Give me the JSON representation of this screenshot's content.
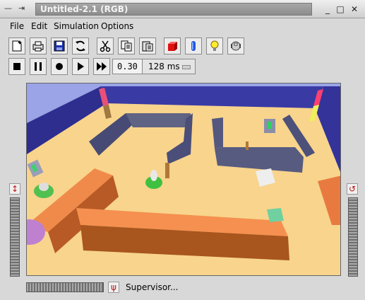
{
  "window": {
    "title": "Untitled-2.1 (RGB)",
    "ctl_minus": "—",
    "ctl_pin": "⇥",
    "minimize": "_",
    "maximize": "□",
    "close": "✕"
  },
  "menu": {
    "items": [
      "File",
      "Edit",
      "Simulation",
      "Options"
    ]
  },
  "toolbar": {
    "row1_icons": [
      "new-document-icon",
      "print-icon",
      "save-icon",
      "refresh-icon",
      "cut-icon",
      "copy-icon",
      "paste-icon",
      "red-box-icon",
      "blue-cylinder-icon",
      "light-bulb-icon",
      "robot-icon"
    ],
    "row2_icons": [
      "stop-icon",
      "pause-icon",
      "record-icon",
      "play-icon",
      "fast-forward-icon"
    ],
    "counter": "0.30",
    "timestep": "128 ms"
  },
  "scene": {
    "colors": {
      "sky": "#9aa4e6",
      "floor": "#f8d48c",
      "wall": "#333399",
      "walls_grey": "#5a5c7c",
      "orange": "#f08a4a"
    }
  },
  "bottom": {
    "supervisor_label": "Supervisor..."
  }
}
